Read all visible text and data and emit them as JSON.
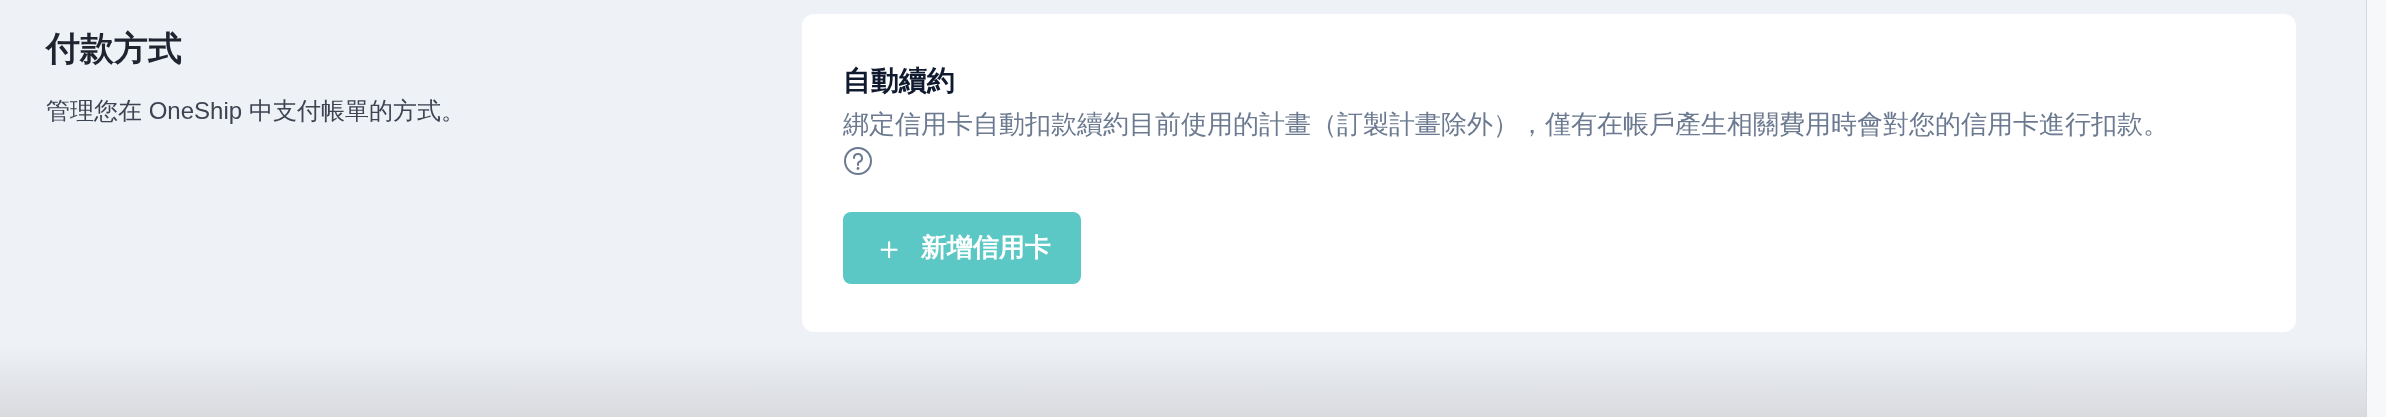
{
  "section": {
    "title": "付款方式",
    "description": "管理您在 OneShip 中支付帳單的方式。"
  },
  "card": {
    "title": "自動續約",
    "description": "綁定信用卡自動扣款續約目前使用的計畫（訂製計畫除外），僅有在帳戶產生相關費用時會對您的信用卡進行扣款。",
    "button": {
      "icon": "＋",
      "label": "新增信用卡"
    }
  }
}
